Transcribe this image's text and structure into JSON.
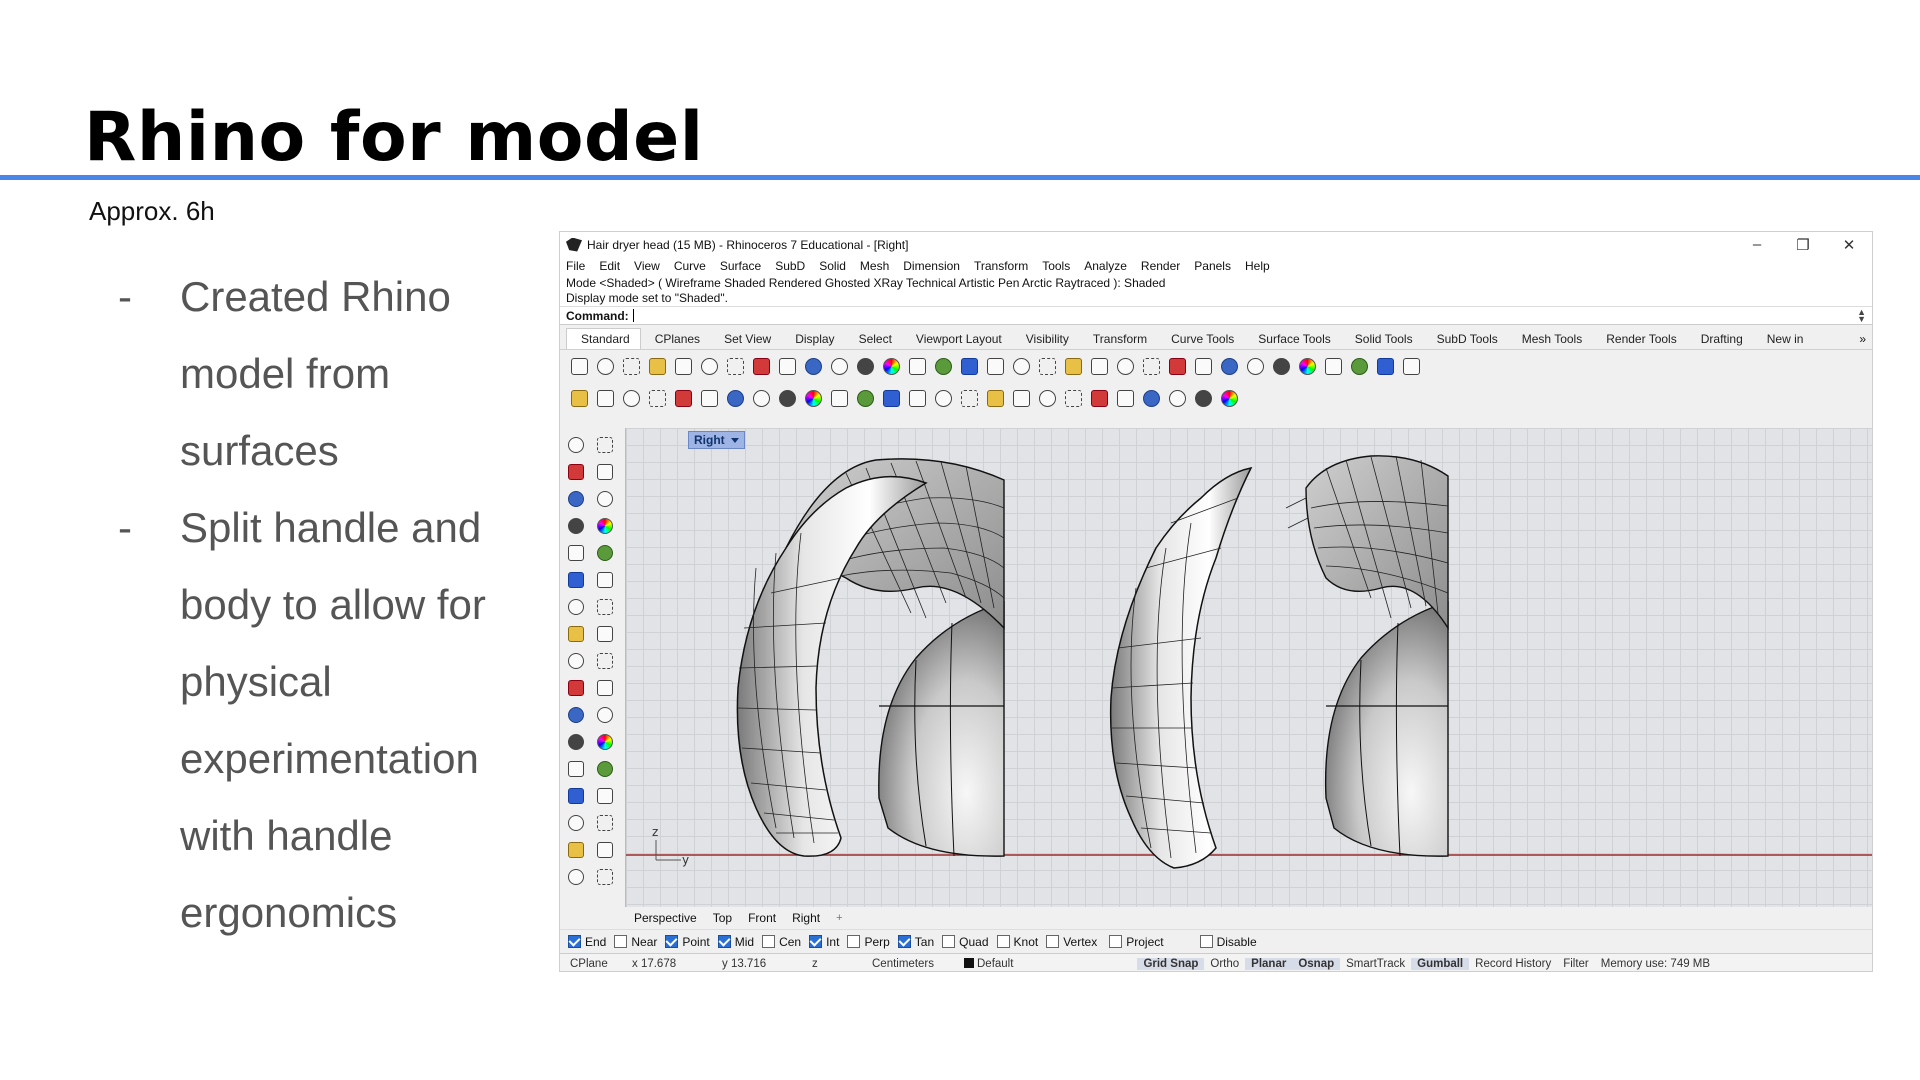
{
  "slide": {
    "title": "Rhino for model",
    "subtitle": "Approx. 6h",
    "bullets": [
      "Created Rhino model from surfaces",
      "Split handle and body to allow for physical experimentation with handle ergonomics"
    ],
    "bullet_marker": "-"
  },
  "window": {
    "title": "Hair dryer head (15 MB) - Rhinoceros 7 Educational - [Right]",
    "controls": {
      "minimize": "–",
      "restore": "❐",
      "close": "✕"
    }
  },
  "menu": [
    "File",
    "Edit",
    "View",
    "Curve",
    "Surface",
    "SubD",
    "Solid",
    "Mesh",
    "Dimension",
    "Transform",
    "Tools",
    "Analyze",
    "Render",
    "Panels",
    "Help"
  ],
  "command_history": [
    "Mode <Shaded> ( Wireframe  Shaded  Rendered  Ghosted  XRay  Technical  Artistic  Pen  Arctic  Raytraced ): Shaded",
    "Display mode set to \"Shaded\"."
  ],
  "command_prompt": "Command:",
  "toolbar_tabs": [
    "Standard",
    "CPlanes",
    "Set View",
    "Display",
    "Select",
    "Viewport Layout",
    "Visibility",
    "Transform",
    "Curve Tools",
    "Surface Tools",
    "Solid Tools",
    "SubD Tools",
    "Mesh Tools",
    "Render Tools",
    "Drafting",
    "New in"
  ],
  "toolbar_more": "»",
  "toolbar_row1_icons": [
    "new-file-icon",
    "open-icon",
    "save-icon",
    "print-icon",
    "import-icon",
    "cut-icon",
    "copy-icon",
    "paste-icon",
    "undo-icon",
    "pan-icon",
    "rotate-view-icon",
    "zoom-icon",
    "zoom-window-icon",
    "zoom-extents-icon",
    "zoom-selected-icon",
    "undo-view-icon",
    "four-views-icon",
    "car-icon",
    "shade-icon",
    "grid-icon",
    "points-icon",
    "light-icon",
    "lock-icon",
    "layer-icon",
    "color-wheel-icon",
    "material-icon",
    "render-sphere-icon",
    "environment-icon",
    "filter-icon",
    "options-icon",
    "snap-icon",
    "globe-icon",
    "help-icon"
  ],
  "toolbar_row2_icons": [
    "curve-icon",
    "polyline-icon",
    "rectangle-icon",
    "arc-icon",
    "extend-icon",
    "pick-icon",
    "text-icon",
    "dim-icon",
    "point-icon",
    "shield-icon",
    "text-icon",
    "text-icon",
    "dimension-icon",
    "leader-icon",
    "edit-icon",
    "cloud-icon",
    "hatch-icon",
    "block-icon",
    "check-icon",
    "clipping-icon",
    "grid-icon",
    "folder-icon",
    "render-ball-icon",
    "rotate-icon",
    "move-icon",
    "split-icon"
  ],
  "viewport": {
    "label": "Right",
    "axis_z": "z",
    "axis_y": "y",
    "tabs": [
      "Perspective",
      "Top",
      "Front",
      "Right"
    ],
    "add_tab": "+"
  },
  "sidebar_icons": [
    "select-icon",
    "point-icon",
    "polyline-icon",
    "curve-icon",
    "circle-icon",
    "ellipse-icon",
    "arc-icon",
    "rectangle-icon",
    "polygon-icon",
    "fillet-icon",
    "surface-icon",
    "patch-icon",
    "box-icon",
    "sphere-icon",
    "cylinder-icon",
    "extrude-icon",
    "boolean-icon",
    "explode-icon",
    "trim-icon",
    "split-icon",
    "group-icon",
    "array-icon",
    "rotate-icon",
    "scale-icon",
    "text-icon",
    "dimension-icon",
    "block-icon",
    "mirror-icon",
    "cube-icon",
    "measure-icon",
    "grid-array-icon",
    "gumball-icon",
    "clipboard-icon",
    "more-icon"
  ],
  "osnaps": [
    {
      "label": "End",
      "checked": true
    },
    {
      "label": "Near",
      "checked": false
    },
    {
      "label": "Point",
      "checked": true
    },
    {
      "label": "Mid",
      "checked": true
    },
    {
      "label": "Cen",
      "checked": false
    },
    {
      "label": "Int",
      "checked": true
    },
    {
      "label": "Perp",
      "checked": false
    },
    {
      "label": "Tan",
      "checked": true
    },
    {
      "label": "Quad",
      "checked": false
    },
    {
      "label": "Knot",
      "checked": false
    },
    {
      "label": "Vertex",
      "checked": false
    },
    {
      "label": "Project",
      "checked": false
    },
    {
      "label": "Disable",
      "checked": false
    }
  ],
  "status": {
    "cplane": "CPlane",
    "x": "x 17.678",
    "y": "y 13.716",
    "z": "z",
    "units": "Centimeters",
    "layer": "Default",
    "grid_snap": "Grid Snap",
    "ortho": "Ortho",
    "planar": "Planar",
    "osnap": "Osnap",
    "smarttrack": "SmartTrack",
    "gumball": "Gumball",
    "record_history": "Record History",
    "filter": "Filter",
    "memory": "Memory use: 749 MB"
  }
}
